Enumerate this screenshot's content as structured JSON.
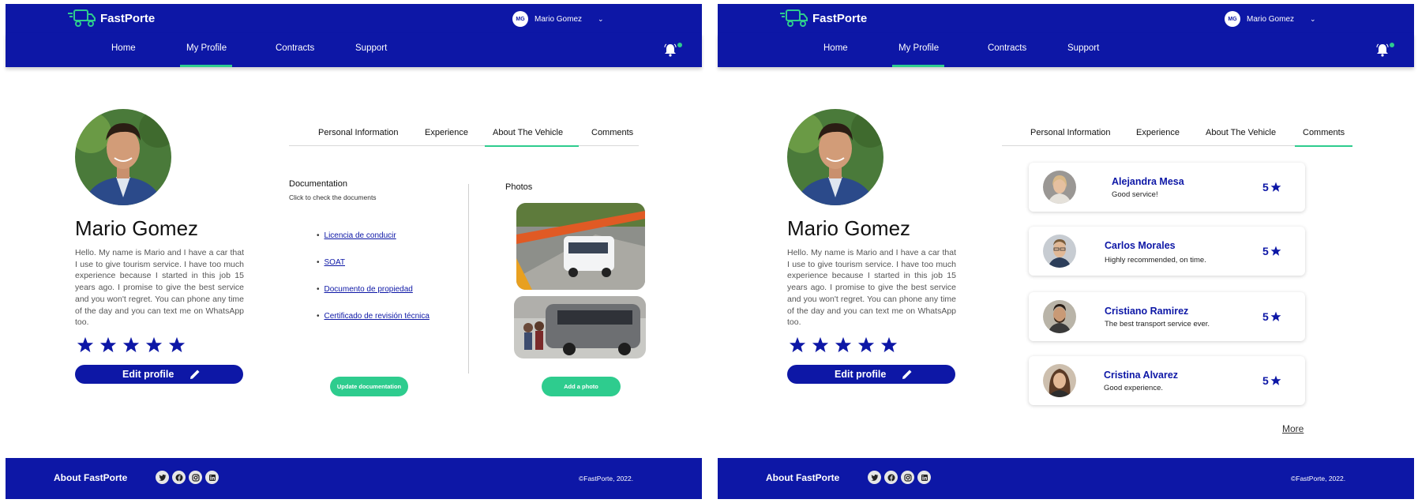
{
  "brand": {
    "name": "FastPorte"
  },
  "colors": {
    "primary": "#0d17a6",
    "accent": "#2ecc8e"
  },
  "user": {
    "initials": "MG",
    "name": "Mario Gomez",
    "menu_icon": "chevron-down-icon"
  },
  "nav": {
    "items": [
      "Home",
      "My Profile",
      "Contracts",
      "Support"
    ],
    "active": "My Profile",
    "notification_icon": "bell-icon"
  },
  "profile": {
    "name": "Mario Gomez",
    "bio": "Hello. My name is Mario and I have a car that I use to give tourism service. I have too much experience because I started in this job 15 years ago. I promise to give the best service and you won't regret. You can phone any time of the day and you can text me on WhatsApp too.",
    "rating": 5,
    "edit_label": "Edit profile",
    "edit_icon": "pencil-icon"
  },
  "tabs": [
    "Personal Information",
    "Experience",
    "About The Vehicle",
    "Comments"
  ],
  "left_panel": {
    "active_tab": "About The Vehicle",
    "documentation": {
      "title": "Documentation",
      "subtitle": "Click to check the documents",
      "items": [
        "Licencia de conducir",
        "SOAT",
        "Documento de propiedad",
        "Certificado de revisión técnica"
      ],
      "button": "Update documentation"
    },
    "photos": {
      "title": "Photos",
      "button": "Add a photo"
    }
  },
  "right_panel": {
    "active_tab": "Comments",
    "comments": [
      {
        "name": "Alejandra Mesa",
        "text": "Good service!",
        "score": "5"
      },
      {
        "name": "Carlos Morales",
        "text": "Highly recommended, on time.",
        "score": "5"
      },
      {
        "name": "Cristiano Ramirez",
        "text": "The best transport service ever.",
        "score": "5"
      },
      {
        "name": "Cristina Alvarez",
        "text": "Good experience.",
        "score": "5"
      }
    ],
    "more": "More"
  },
  "footer": {
    "about": "About FastPorte",
    "socials": [
      "twitter-icon",
      "facebook-icon",
      "instagram-icon",
      "linkedin-icon"
    ],
    "copyright": "©FastPorte, 2022."
  }
}
